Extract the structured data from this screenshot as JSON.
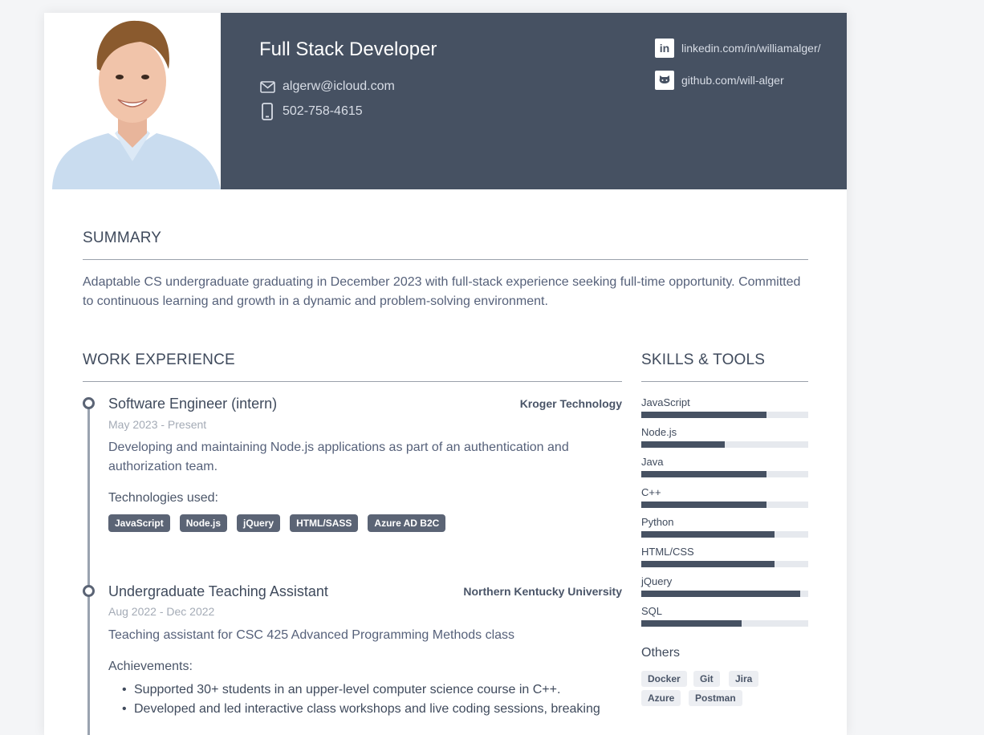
{
  "header": {
    "title": "Full Stack Developer",
    "email": "algerw@icloud.com",
    "phone": "502-758-4615",
    "linkedin": "linkedin.com/in/williamalger/",
    "github": "github.com/will-alger"
  },
  "summary": {
    "heading": "SUMMARY",
    "text": "Adaptable CS undergraduate graduating in December 2023 with full-stack experience seeking full-time opportunity. Committed to continuous learning and growth in a dynamic and problem-solving environment."
  },
  "experience": {
    "heading": "WORK EXPERIENCE",
    "jobs": [
      {
        "title": "Software Engineer (intern)",
        "company": "Kroger Technology",
        "dates": "May 2023 - Present",
        "description": "Developing and maintaining Node.js applications as part of an authentication and authorization team.",
        "sub_heading": "Technologies used:",
        "tags": [
          "JavaScript",
          "Node.js",
          "jQuery",
          "HTML/SASS",
          "Azure AD B2C"
        ]
      },
      {
        "title": "Undergraduate Teaching Assistant",
        "company": "Northern Kentucky University",
        "dates": "Aug 2022 - Dec 2022",
        "description": "Teaching assistant for CSC 425 Advanced Programming Methods class",
        "sub_heading": "Achievements:",
        "bullets": [
          "Supported 30+ students in an upper-level computer science course in C++.",
          "Developed and led interactive class workshops and live coding sessions, breaking"
        ]
      }
    ]
  },
  "skills": {
    "heading": "SKILLS & TOOLS",
    "items": [
      {
        "name": "JavaScript",
        "level": 0.75
      },
      {
        "name": "Node.js",
        "level": 0.5
      },
      {
        "name": "Java",
        "level": 0.75
      },
      {
        "name": "C++",
        "level": 0.75
      },
      {
        "name": "Python",
        "level": 0.8
      },
      {
        "name": "HTML/CSS",
        "level": 0.8
      },
      {
        "name": "jQuery",
        "level": 0.95
      },
      {
        "name": "SQL",
        "level": 0.6
      }
    ],
    "others_heading": "Others",
    "others": [
      "Docker",
      "Git",
      "Jira",
      "Azure",
      "Postman"
    ]
  },
  "colors": {
    "header_bg": "#465162",
    "tag_bg": "#5b6475",
    "bar_fill": "#465162",
    "bar_track": "#e6e9ee"
  }
}
